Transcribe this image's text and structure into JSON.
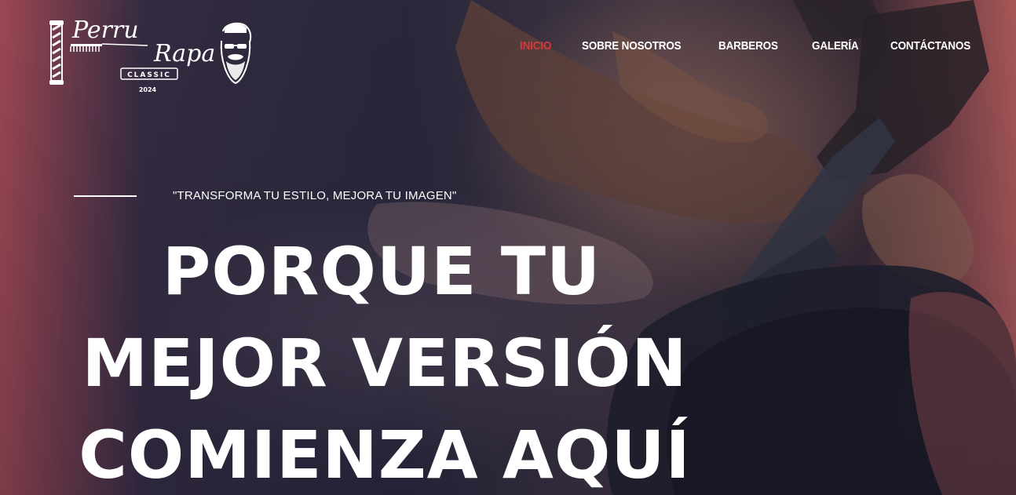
{
  "brand": {
    "name_part1": "Perru",
    "name_part2": "Rapa",
    "badge": "CLASSIC",
    "year": "2024",
    "icons": [
      "barber-pole-icon",
      "comb-icon",
      "bearded-man-icon"
    ]
  },
  "nav": {
    "items": [
      {
        "label": "INICIO",
        "active": true
      },
      {
        "label": "SOBRE NOSOTROS",
        "active": false
      },
      {
        "label": "BARBEROS",
        "active": false
      },
      {
        "label": "GALERÍA",
        "active": false
      },
      {
        "label": "CONTÁCTANOS",
        "active": false
      }
    ]
  },
  "hero": {
    "tagline": "\"TRANSFORMA TU ESTILO, MEJORA TU IMAGEN\"",
    "headline": [
      "PORQUE TU",
      "MEJOR VERSIÓN",
      "COMIENZA AQUÍ"
    ]
  },
  "colors": {
    "accent": "#d6393d",
    "text": "#ffffff"
  }
}
